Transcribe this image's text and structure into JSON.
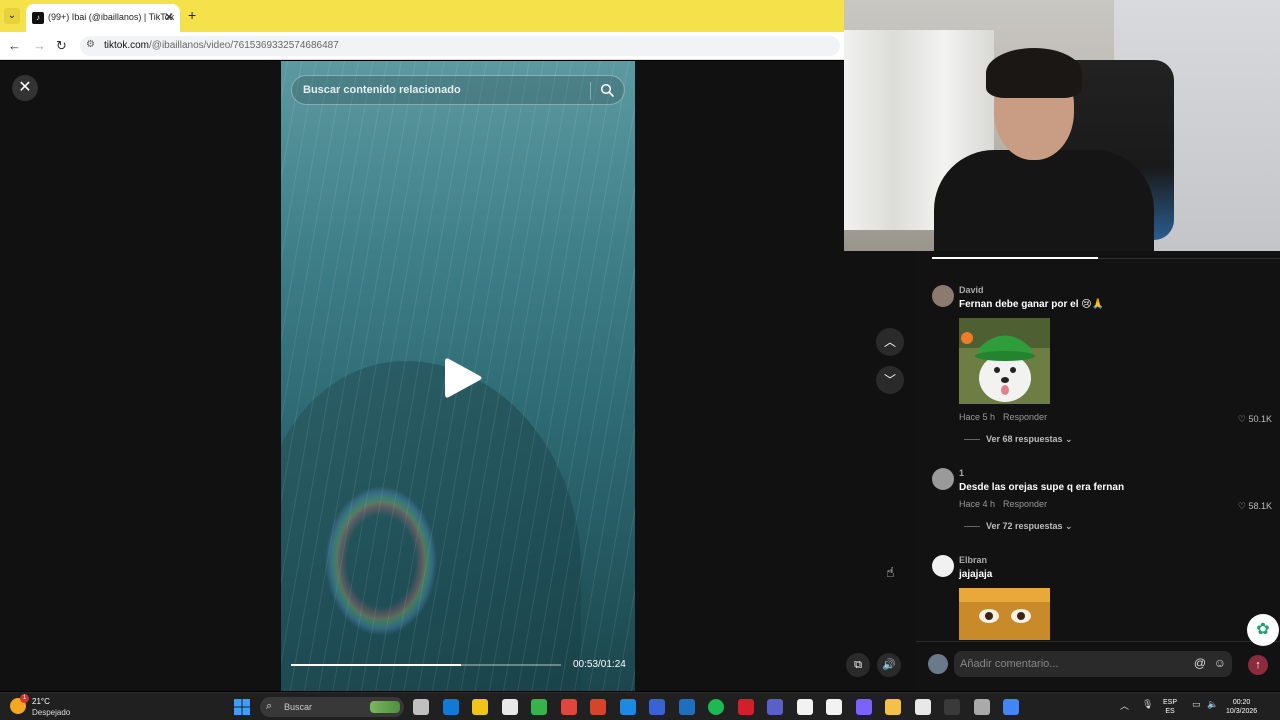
{
  "browser": {
    "tab_title": "(99+) Ibai (@ibaillanos) | TikTok",
    "url_host": "tiktok.com",
    "url_path": "/@ibaillanos/video/7615369332574686487"
  },
  "player": {
    "search_placeholder": "Buscar contenido relacionado",
    "time": "00:53/01:24",
    "progress_fraction": 0.63
  },
  "comments": [
    {
      "user": "David",
      "text": "Fernan debe ganar por el 😢🙏",
      "has_image": true,
      "meta_time": "Hace 5 h",
      "reply_label": "Responder",
      "likes": "50.1K",
      "replies": "Ver 68 respuestas ⌄"
    },
    {
      "user": "1",
      "text": "Desde las orejas supe q era fernan",
      "has_image": false,
      "meta_time": "Hace 4 h",
      "reply_label": "Responder",
      "likes": "58.1K",
      "replies": "Ver 72 respuestas ⌄"
    },
    {
      "user": "Elbran",
      "text": "jajajaja",
      "has_image": true
    }
  ],
  "comment_bar": {
    "placeholder": "Añadir comentario...",
    "at_icon": "@",
    "emoji_icon": "☺"
  },
  "taskbar": {
    "temp": "21°C",
    "weather": "Despejado",
    "weather_badge": "1",
    "search_label": "Buscar",
    "lang_top": "ESP",
    "lang_bottom": "ES",
    "time": "00:20",
    "date": "10/3/2026",
    "app_colors": [
      "#c0c0c0",
      "#0f7bd6",
      "#f0c419",
      "#e9e9e9",
      "#36b34a",
      "#e2453c",
      "#d6442b",
      "#1e88e5",
      "#3a62d8",
      "#1f6fbf",
      "#1db954",
      "#d21f2b",
      "#5b5fc7",
      "#f2f2f2",
      "#f2f2f2",
      "#7b61ff",
      "#f5c04a",
      "#e8e8e8",
      "#3a3a3a",
      "#aaaaaa",
      "#4285f4"
    ]
  },
  "colors": {
    "tabbar": "#f5e24a",
    "send_button": "#8a2c3d",
    "panel_bg": "#121212"
  }
}
